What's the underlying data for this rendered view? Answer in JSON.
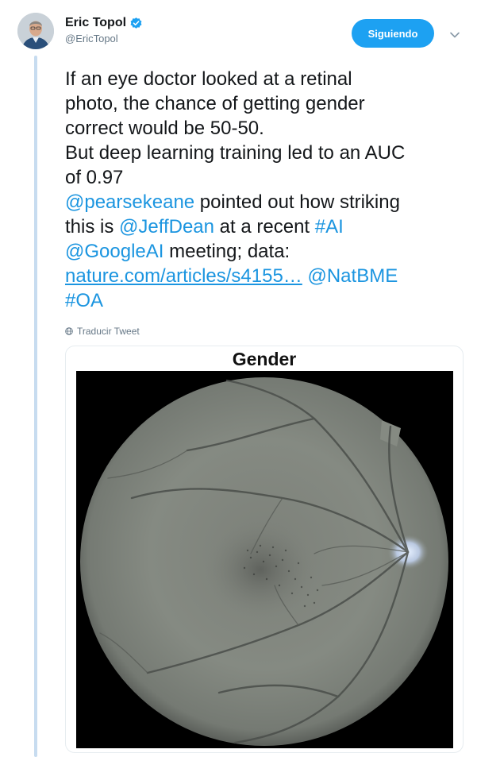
{
  "tweet": {
    "author": {
      "name": "Eric Topol",
      "handle": "@EricTopol",
      "verified": true
    },
    "follow_button_label": "Siguiendo",
    "text": {
      "line1": "If an eye doctor looked at a retinal",
      "line2": "photo, the chance of getting gender",
      "line3": "correct would be 50-50.",
      "line4": "But deep learning training led to an AUC",
      "line5": "of 0.97",
      "mention_pearsekeane": "@pearsekeane",
      "line6_rest": " pointed out how striking",
      "line7_start": "this is ",
      "mention_jeffdean": "@JeffDean",
      "line7_mid": " at a recent ",
      "hashtag_ai": "#AI",
      "mention_googleai": "@GoogleAI",
      "line8_rest": " meeting; data:",
      "url": "nature.com/articles/s4155…",
      "mention_natbme": "@NatBME",
      "hashtag_oa": "#OA"
    },
    "translate_label": "Traducir Tweet",
    "media": {
      "title": "Gender",
      "image_alt": "retinal-fundus-photo"
    }
  },
  "colors": {
    "brand_blue": "#1da1f2",
    "link_blue": "#1b95e0",
    "text_primary": "#14171a",
    "text_secondary": "#657786",
    "thread_line": "#c7dcf0"
  },
  "icons": {
    "verified": "verified-badge-icon",
    "caret": "chevron-down-icon",
    "translate": "globe-icon"
  }
}
